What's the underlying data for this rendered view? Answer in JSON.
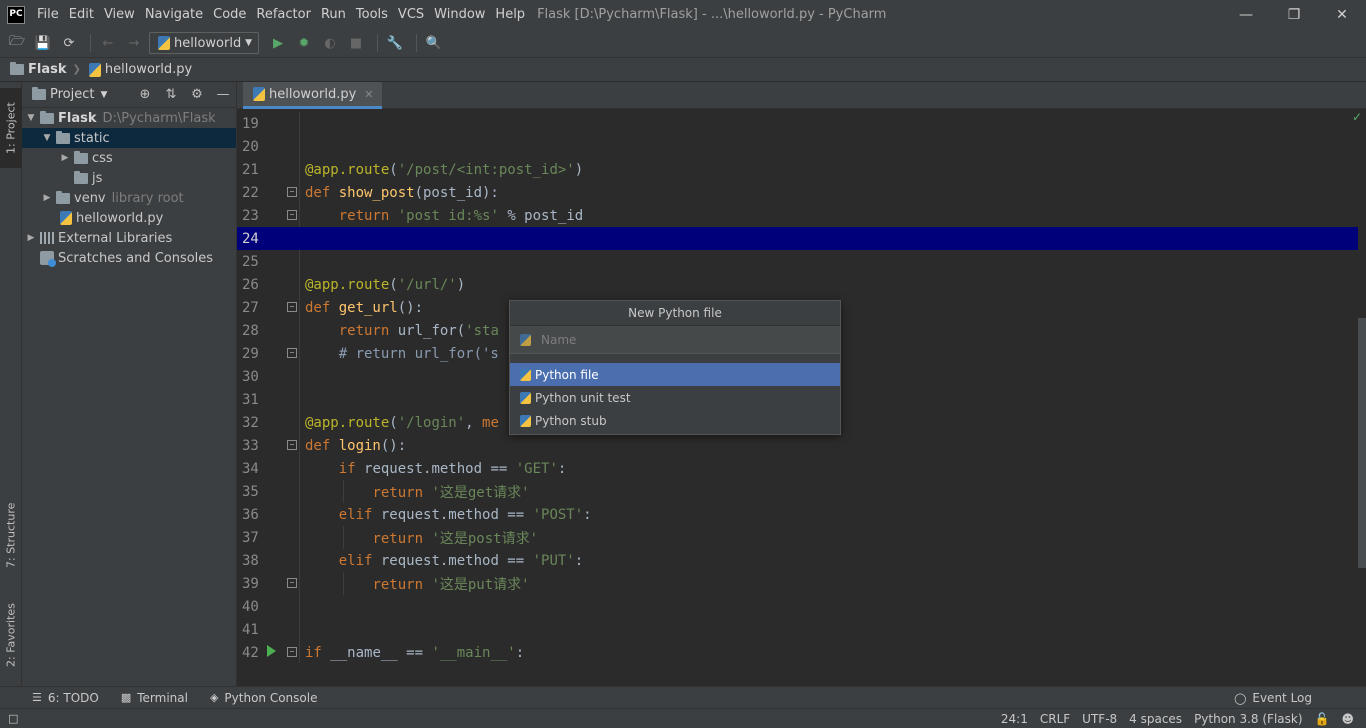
{
  "window": {
    "app_icon": "PC",
    "title": "Flask [D:\\Pycharm\\Flask] - ...\\helloworld.py - PyCharm",
    "controls": [
      "minimize-icon",
      "restore-icon",
      "close-icon"
    ]
  },
  "menu": [
    "File",
    "Edit",
    "View",
    "Navigate",
    "Code",
    "Refactor",
    "Run",
    "Tools",
    "VCS",
    "Window",
    "Help"
  ],
  "toolbar": {
    "run_config": "helloworld"
  },
  "breadcrumb": {
    "project": "Flask",
    "file": "helloworld.py"
  },
  "left_strip": {
    "project_tab": "1: Project",
    "structure_tab": "7: Structure",
    "favorites_tab": "2: Favorites"
  },
  "project_panel": {
    "title": "Project",
    "tree": [
      {
        "label": "Flask",
        "extra": "D:\\Pycharm\\Flask"
      },
      {
        "label": "static"
      },
      {
        "label": "css"
      },
      {
        "label": "js"
      },
      {
        "label": "venv",
        "extra": "library root"
      },
      {
        "label": "helloworld.py"
      },
      {
        "label": "External Libraries"
      },
      {
        "label": "Scratches and Consoles"
      }
    ]
  },
  "editor": {
    "tab": "helloworld.py",
    "current_line": "24",
    "line_numbers": [
      "19",
      "20",
      "21",
      "22",
      "23",
      "24",
      "25",
      "26",
      "27",
      "28",
      "29",
      "30",
      "31",
      "32",
      "33",
      "34",
      "35",
      "36",
      "37",
      "38",
      "39",
      "40",
      "41",
      "42"
    ],
    "lines": [
      {
        "tokens": []
      },
      {
        "tokens": []
      },
      {
        "tokens": [
          [
            "dec",
            "@app.route"
          ],
          [
            "p",
            "("
          ],
          [
            "str",
            "'/post/<int:post_id>'"
          ],
          [
            "p",
            ")"
          ]
        ]
      },
      {
        "tokens": [
          [
            "kw",
            "def "
          ],
          [
            "fn",
            "show_post"
          ],
          [
            "p",
            "(post_id):"
          ]
        ]
      },
      {
        "tokens": [
          [
            "p",
            "    "
          ],
          [
            "kw",
            "return "
          ],
          [
            "str",
            "'post id:%s'"
          ],
          [
            "p",
            " % post_id"
          ]
        ]
      },
      {
        "tokens": []
      },
      {
        "tokens": []
      },
      {
        "tokens": [
          [
            "dec",
            "@app.route"
          ],
          [
            "p",
            "("
          ],
          [
            "str",
            "'/url/'"
          ],
          [
            "p",
            ")"
          ]
        ]
      },
      {
        "tokens": [
          [
            "kw",
            "def "
          ],
          [
            "fn",
            "get_url"
          ],
          [
            "p",
            "():"
          ]
        ]
      },
      {
        "tokens": [
          [
            "p",
            "    "
          ],
          [
            "kw",
            "return "
          ],
          [
            "p",
            "url_for("
          ],
          [
            "str",
            "'sta"
          ]
        ]
      },
      {
        "tokens": [
          [
            "p",
            "    "
          ],
          [
            "cm",
            "# return url_for('s"
          ]
        ]
      },
      {
        "tokens": []
      },
      {
        "tokens": []
      },
      {
        "tokens": [
          [
            "dec",
            "@app.route"
          ],
          [
            "p",
            "("
          ],
          [
            "str",
            "'/login'"
          ],
          [
            "p",
            ", "
          ],
          [
            "kw",
            "me"
          ]
        ]
      },
      {
        "tokens": [
          [
            "kw",
            "def "
          ],
          [
            "fn",
            "login"
          ],
          [
            "p",
            "():"
          ]
        ]
      },
      {
        "tokens": [
          [
            "p",
            "    "
          ],
          [
            "kw",
            "if "
          ],
          [
            "p",
            "request.method == "
          ],
          [
            "str",
            "'GET'"
          ],
          [
            "p",
            ":"
          ]
        ]
      },
      {
        "tokens": [
          [
            "p",
            "        "
          ],
          [
            "kw",
            "return "
          ],
          [
            "str",
            "'这是get请求'"
          ]
        ]
      },
      {
        "tokens": [
          [
            "p",
            "    "
          ],
          [
            "kw",
            "elif "
          ],
          [
            "p",
            "request.method == "
          ],
          [
            "str",
            "'POST'"
          ],
          [
            "p",
            ":"
          ]
        ]
      },
      {
        "tokens": [
          [
            "p",
            "        "
          ],
          [
            "kw",
            "return "
          ],
          [
            "str",
            "'这是post请求'"
          ]
        ]
      },
      {
        "tokens": [
          [
            "p",
            "    "
          ],
          [
            "kw",
            "elif "
          ],
          [
            "p",
            "request.method == "
          ],
          [
            "str",
            "'PUT'"
          ],
          [
            "p",
            ":"
          ]
        ]
      },
      {
        "tokens": [
          [
            "p",
            "        "
          ],
          [
            "kw",
            "return "
          ],
          [
            "str",
            "'这是put请求'"
          ]
        ]
      },
      {
        "tokens": []
      },
      {
        "tokens": []
      },
      {
        "tokens": [
          [
            "kw",
            "if "
          ],
          [
            "p",
            "__name__ == "
          ],
          [
            "str",
            "'__main__'"
          ],
          [
            "p",
            ":"
          ]
        ]
      }
    ]
  },
  "popup": {
    "title": "New Python file",
    "input_placeholder": "Name",
    "items": [
      "Python file",
      "Python unit test",
      "Python stub"
    ],
    "selected_index": 0
  },
  "tool_windows": {
    "todo": "6: TODO",
    "terminal": "Terminal",
    "python_console": "Python Console",
    "event_log": "Event Log"
  },
  "status": {
    "position": "24:1",
    "line_separator": "CRLF",
    "encoding": "UTF-8",
    "indent": "4 spaces",
    "interpreter": "Python 3.8 (Flask)"
  }
}
